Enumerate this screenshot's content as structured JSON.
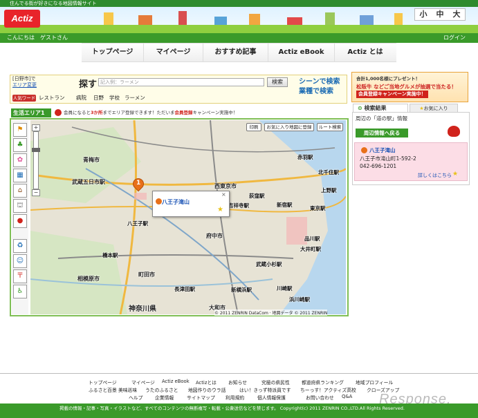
{
  "top": {
    "tagline": "住んでる街が好きになる地図情報サイト"
  },
  "header": {
    "logo": "Actiz",
    "sizes": [
      "小",
      "中",
      "大"
    ]
  },
  "welcome": {
    "greeting": "こんにちは　ゲストさん",
    "login": "ログイン"
  },
  "nav": [
    "トップページ",
    "マイページ",
    "おすすめ記事",
    "Actiz eBook",
    "Actiz とは"
  ],
  "search": {
    "area_line1": "[日野市]で",
    "area_line2": "エリア変更",
    "title": "探す",
    "placeholder": "記入例：ラーメン",
    "button": "検索",
    "scene": "シーンで検索",
    "gyoshu": "業種で検索",
    "keyword_badge": "人気ワード",
    "keywords": [
      "レストラン",
      "病院",
      "日野",
      "学校",
      "ラーメン"
    ]
  },
  "promo": {
    "line1": "合計1,000名様にプレゼント！",
    "line2": "松阪牛 などご当地グルメが抽選で当たる！",
    "line3": "会員登録キャンペーン実施中！"
  },
  "life_area": {
    "label": "生活エリア1",
    "note_pre": "会員になると",
    "note_red1": "3か所",
    "note_mid": "までエリア登録できます！ただいま",
    "note_red2": "会員登録",
    "note_post": "キャンペーン実施中！"
  },
  "map": {
    "buttons": [
      "印刷",
      "お気に入り地図に登録",
      "ルート検索"
    ],
    "popup_title": "八王子滝山",
    "copyright": "© 2011 ZENRIN DataCom · 地図データ © 2011 ZENRIN",
    "places": [
      "武蔵五日市駅",
      "八王子駅",
      "橋本駅",
      "神奈川県",
      "長津田駅",
      "新横浜駅",
      "武蔵小杉駅",
      "川崎駅",
      "浜川崎駅",
      "大井町駅",
      "品川駅",
      "東京駅",
      "新宿駅",
      "赤羽駅",
      "上野駅",
      "北千住駅",
      "吉祥寺駅",
      "西東京市",
      "荻窪駅",
      "青梅市",
      "府中市",
      "町田市",
      "相模原市",
      "大和市"
    ]
  },
  "panel": {
    "tab_results": "検索結果",
    "tab_fav": "お気に入り",
    "title": "周辺の「道の駅」情報",
    "near_button": "周辺情報へ戻る",
    "result": {
      "name": "八王子滝山",
      "address": "八王子市滝山町1-592-2",
      "phone": "042-696-1201",
      "detail": "詳しくはこちら"
    }
  },
  "footer": {
    "row1": [
      "トップページ",
      "マイページ",
      "Actiz eBook",
      "Actizとは",
      "お知らせ",
      "究極の県民性",
      "都道府県ランキング",
      "地域プロフィール"
    ],
    "row2": [
      "ふるさと百景 美味巡味",
      "うたのふるさと",
      "地図作りのウラ話",
      "はい！きっず特派員です",
      "ちーっす！アクティズ高校",
      "クローズアップ"
    ],
    "row3": [
      "ヘルプ",
      "企業情報",
      "サイトマップ",
      "利用規約",
      "個人情報保護",
      "お問い合わせ",
      "Q&A"
    ],
    "copyright": "掲載の情報・記事・写真・イラストなど、すべてのコンテンツの無断複写・転載・公衆送信などを禁じます。 Copyright(c) 2011 ZENRIN CO.,LTD.All Rights Reserved."
  },
  "watermark": "Response."
}
